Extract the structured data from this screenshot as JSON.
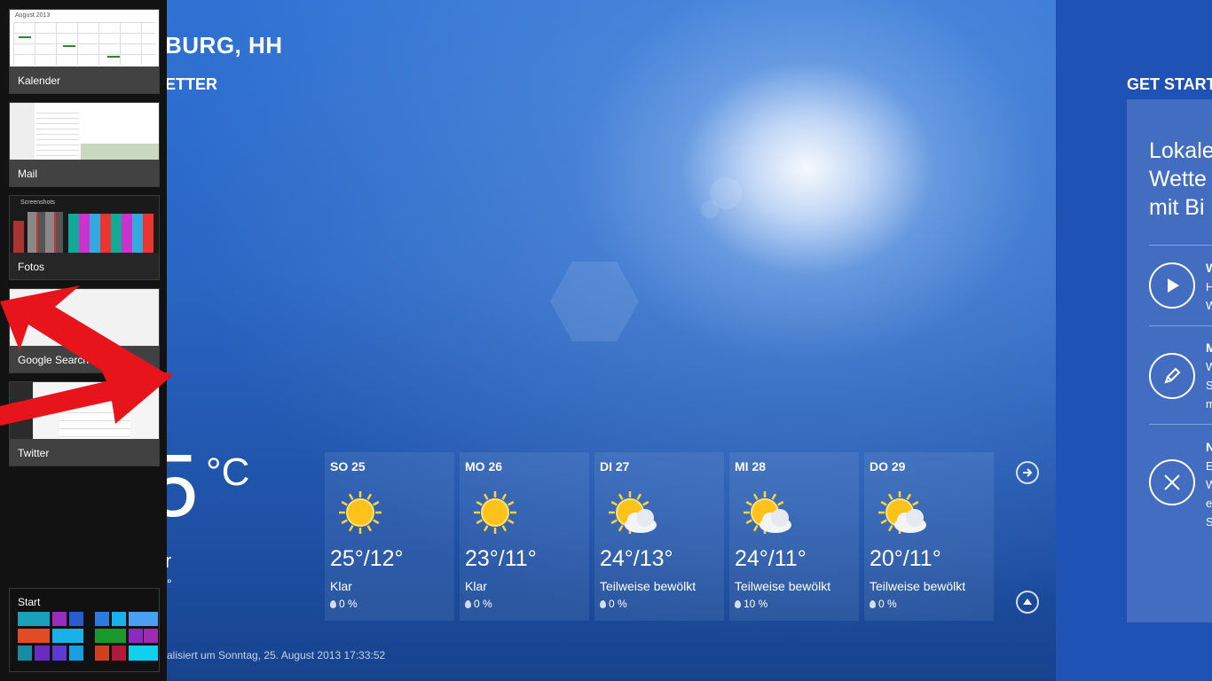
{
  "weather": {
    "city": "BURG, HH",
    "subheading": "ETTER",
    "current_temp": "5",
    "current_unit": "°C",
    "current_fragment_1": "r",
    "current_fragment_2": "°",
    "updated_text": "alisiert um Sonntag, 25. August 2013 17:33:52",
    "forecast": [
      {
        "day": "SO 25",
        "temps": "25°/12°",
        "condition": "Klar",
        "precip": "0 %",
        "icon": "sun-icon"
      },
      {
        "day": "MO 26",
        "temps": "23°/11°",
        "condition": "Klar",
        "precip": "0 %",
        "icon": "sun-icon"
      },
      {
        "day": "DI 27",
        "temps": "24°/13°",
        "condition": "Teilweise bewölkt",
        "precip": "0 %",
        "icon": "partly-cloudy-icon"
      },
      {
        "day": "MI 28",
        "temps": "24°/11°",
        "condition": "Teilweise bewölkt",
        "precip": "10 %",
        "icon": "partly-cloudy-icon"
      },
      {
        "day": "DO 29",
        "temps": "20°/11°",
        "condition": "Teilweise bewölkt",
        "precip": "0 %",
        "icon": "partly-cloudy-icon"
      }
    ]
  },
  "get_started": {
    "title": "GET START",
    "text_lines": [
      "Lokale",
      "Wette",
      "mit Bi"
    ],
    "items": [
      {
        "icon": "play-icon",
        "lines": [
          "W",
          "H",
          "W"
        ]
      },
      {
        "icon": "pencil-icon",
        "lines": [
          "M",
          "W",
          "S",
          "m"
        ]
      },
      {
        "icon": "close-icon",
        "lines": [
          "N",
          "E",
          "W",
          "e",
          "S"
        ]
      }
    ]
  },
  "switcher": {
    "apps": [
      {
        "label": "Kalender"
      },
      {
        "label": "Mail"
      },
      {
        "label": "Fotos"
      },
      {
        "label": "Google Search"
      },
      {
        "label": "Twitter"
      }
    ],
    "kalender_header": "August 2013",
    "fotos_header": "Screenshots",
    "start_label": "Start"
  },
  "colors": {
    "switcher_bg": "#121212",
    "right_panel": "#1f52b5",
    "arrow_red": "#e8141c"
  }
}
